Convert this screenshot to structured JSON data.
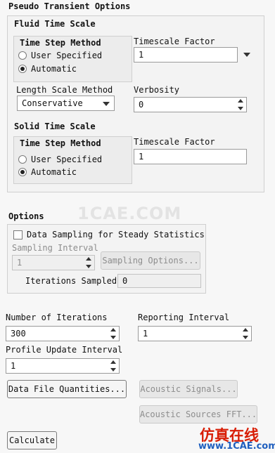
{
  "pseudo_transient": {
    "title": "Pseudo Transient Options",
    "fluid": {
      "title": "Fluid Time Scale",
      "time_step_method": {
        "title": "Time Step Method",
        "options": [
          "User Specified",
          "Automatic"
        ],
        "selected": "Automatic"
      },
      "timescale_factor": {
        "label": "Timescale Factor",
        "value": "1"
      },
      "length_scale_method": {
        "label": "Length Scale Method",
        "value": "Conservative"
      },
      "verbosity": {
        "label": "Verbosity",
        "value": "0"
      }
    },
    "solid": {
      "title": "Solid Time Scale",
      "time_step_method": {
        "title": "Time Step Method",
        "options": [
          "User Specified",
          "Automatic"
        ],
        "selected": "Automatic"
      },
      "timescale_factor": {
        "label": "Timescale Factor",
        "value": "1"
      }
    }
  },
  "options": {
    "title": "Options",
    "data_sampling": {
      "label": "Data Sampling for Steady Statistics",
      "checked": false
    },
    "sampling_interval": {
      "label": "Sampling Interval",
      "value": "1"
    },
    "sampling_options_label": "Sampling Options...",
    "iterations_sampled": {
      "label": "Iterations Sampled",
      "value": "0"
    }
  },
  "run": {
    "number_of_iterations": {
      "label": "Number of Iterations",
      "value": "300"
    },
    "reporting_interval": {
      "label": "Reporting Interval",
      "value": "1"
    },
    "profile_update_interval": {
      "label": "Profile Update Interval",
      "value": "1"
    }
  },
  "buttons": {
    "data_file_quantities": "Data File Quantities...",
    "acoustic_signals": "Acoustic Signals...",
    "acoustic_sources_fft": "Acoustic Sources FFT...",
    "calculate": "Calculate"
  },
  "watermark": {
    "center": "1CAE.COM",
    "brand_cn": "仿真在线",
    "brand_url": "www.1CAE.com"
  },
  "icons": {
    "radio": "radio-icon",
    "checkbox": "checkbox-icon",
    "spinner": "spinner-icon",
    "dropdown": "chevron-down-icon"
  },
  "colors": {
    "background": "#f7f7f7",
    "group_border": "#cfcfcf",
    "disabled_text": "#8d8d8d",
    "brand_red": "#d81e06",
    "brand_blue": "#1f5fbf"
  }
}
